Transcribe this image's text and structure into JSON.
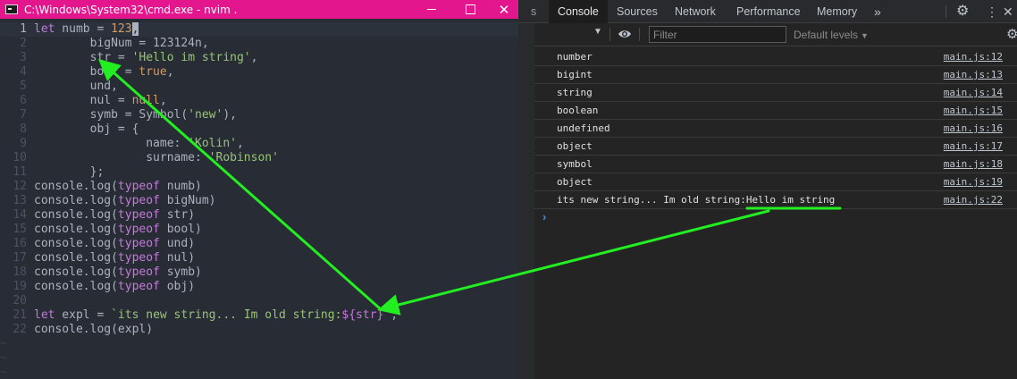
{
  "terminal": {
    "title": "C:\\Windows\\System32\\cmd.exe - nvim  .",
    "min_icon": "minimize-icon",
    "max_icon": "maximize-icon",
    "close_glyph": "✕",
    "cursor_line": 1,
    "lines": [
      {
        "n": "1",
        "tokens": [
          {
            "t": "let",
            "c": "kw"
          },
          {
            "t": " numb = ",
            "c": "plain"
          },
          {
            "t": "123",
            "c": "num"
          },
          {
            "t": ",",
            "c": "cursor"
          }
        ]
      },
      {
        "n": "2",
        "tokens": [
          {
            "t": "        bigNum = 123124n,",
            "c": "plain"
          }
        ]
      },
      {
        "n": "3",
        "tokens": [
          {
            "t": "        str = ",
            "c": "plain"
          },
          {
            "t": "'Hello im string'",
            "c": "str"
          },
          {
            "t": ",",
            "c": "plain"
          }
        ]
      },
      {
        "n": "4",
        "tokens": [
          {
            "t": "        bool = ",
            "c": "plain"
          },
          {
            "t": "true",
            "c": "num"
          },
          {
            "t": ",",
            "c": "plain"
          }
        ]
      },
      {
        "n": "5",
        "tokens": [
          {
            "t": "        und,",
            "c": "plain"
          }
        ]
      },
      {
        "n": "6",
        "tokens": [
          {
            "t": "        nul = ",
            "c": "plain"
          },
          {
            "t": "null",
            "c": "num"
          },
          {
            "t": ",",
            "c": "plain"
          }
        ]
      },
      {
        "n": "7",
        "tokens": [
          {
            "t": "        symb = Symbol(",
            "c": "plain"
          },
          {
            "t": "'new'",
            "c": "str"
          },
          {
            "t": "),",
            "c": "plain"
          }
        ]
      },
      {
        "n": "8",
        "tokens": [
          {
            "t": "        obj = {",
            "c": "plain"
          }
        ]
      },
      {
        "n": "9",
        "tokens": [
          {
            "t": "                name: ",
            "c": "plain"
          },
          {
            "t": "'Kolin'",
            "c": "str"
          },
          {
            "t": ",",
            "c": "plain"
          }
        ]
      },
      {
        "n": "10",
        "tokens": [
          {
            "t": "                surname: ",
            "c": "plain"
          },
          {
            "t": "'Robinson'",
            "c": "str"
          }
        ]
      },
      {
        "n": "11",
        "tokens": [
          {
            "t": "        };",
            "c": "plain"
          }
        ]
      },
      {
        "n": "12",
        "tokens": [
          {
            "t": "console.log(",
            "c": "plain"
          },
          {
            "t": "typeof",
            "c": "kw"
          },
          {
            "t": " numb)",
            "c": "plain"
          }
        ]
      },
      {
        "n": "13",
        "tokens": [
          {
            "t": "console.log(",
            "c": "plain"
          },
          {
            "t": "typeof",
            "c": "kw"
          },
          {
            "t": " bigNum)",
            "c": "plain"
          }
        ]
      },
      {
        "n": "14",
        "tokens": [
          {
            "t": "console.log(",
            "c": "plain"
          },
          {
            "t": "typeof",
            "c": "kw"
          },
          {
            "t": " str)",
            "c": "plain"
          }
        ]
      },
      {
        "n": "15",
        "tokens": [
          {
            "t": "console.log(",
            "c": "plain"
          },
          {
            "t": "typeof",
            "c": "kw"
          },
          {
            "t": " bool)",
            "c": "plain"
          }
        ]
      },
      {
        "n": "16",
        "tokens": [
          {
            "t": "console.log(",
            "c": "plain"
          },
          {
            "t": "typeof",
            "c": "kw"
          },
          {
            "t": " und)",
            "c": "plain"
          }
        ]
      },
      {
        "n": "17",
        "tokens": [
          {
            "t": "console.log(",
            "c": "plain"
          },
          {
            "t": "typeof",
            "c": "kw"
          },
          {
            "t": " nul)",
            "c": "plain"
          }
        ]
      },
      {
        "n": "18",
        "tokens": [
          {
            "t": "console.log(",
            "c": "plain"
          },
          {
            "t": "typeof",
            "c": "kw"
          },
          {
            "t": " symb)",
            "c": "plain"
          }
        ]
      },
      {
        "n": "19",
        "tokens": [
          {
            "t": "console.log(",
            "c": "plain"
          },
          {
            "t": "typeof",
            "c": "kw"
          },
          {
            "t": " obj)",
            "c": "plain"
          }
        ]
      },
      {
        "n": "20",
        "tokens": []
      },
      {
        "n": "21",
        "tokens": [
          {
            "t": "let",
            "c": "kw"
          },
          {
            "t": " expl = ",
            "c": "plain"
          },
          {
            "t": "`its new string... Im old string:",
            "c": "str"
          },
          {
            "t": "${str}",
            "c": "kw"
          },
          {
            "t": "`",
            "c": "str"
          },
          {
            "t": ";",
            "c": "plain"
          }
        ]
      },
      {
        "n": "22",
        "tokens": [
          {
            "t": "console.log(expl)",
            "c": "plain"
          }
        ]
      }
    ]
  },
  "devtools": {
    "tabs": {
      "partial": "s",
      "console": "Console",
      "sources": "Sources",
      "network": "Network",
      "performance": "Performance",
      "memory": "Memory",
      "more": "»"
    },
    "icons": {
      "settings": "⚙",
      "menu": "⋮",
      "close": "✕",
      "context_caret": "▼",
      "gear": "⚙"
    },
    "filter": {
      "placeholder": "Filter",
      "value": ""
    },
    "levels": {
      "label": "Default levels",
      "caret": "▼"
    },
    "console_logs": [
      {
        "msg": "number",
        "src": "main.js:12"
      },
      {
        "msg": "bigint",
        "src": "main.js:13"
      },
      {
        "msg": "string",
        "src": "main.js:14"
      },
      {
        "msg": "boolean",
        "src": "main.js:15"
      },
      {
        "msg": "undefined",
        "src": "main.js:16"
      },
      {
        "msg": "object",
        "src": "main.js:17"
      },
      {
        "msg": "symbol",
        "src": "main.js:18"
      },
      {
        "msg": "object",
        "src": "main.js:19"
      },
      {
        "msg": "its new string... Im old string:Hello im string",
        "src": "main.js:22"
      }
    ],
    "prompt_glyph": "›"
  },
  "colors": {
    "title_bar": "#e4168e",
    "editor_bg": "#282c34",
    "devtools_bg": "#242424",
    "annotation": "#22ee22",
    "keyword": "#c678dd",
    "number": "#d19a66",
    "string": "#98c379",
    "prompt": "#3d8fe3"
  }
}
